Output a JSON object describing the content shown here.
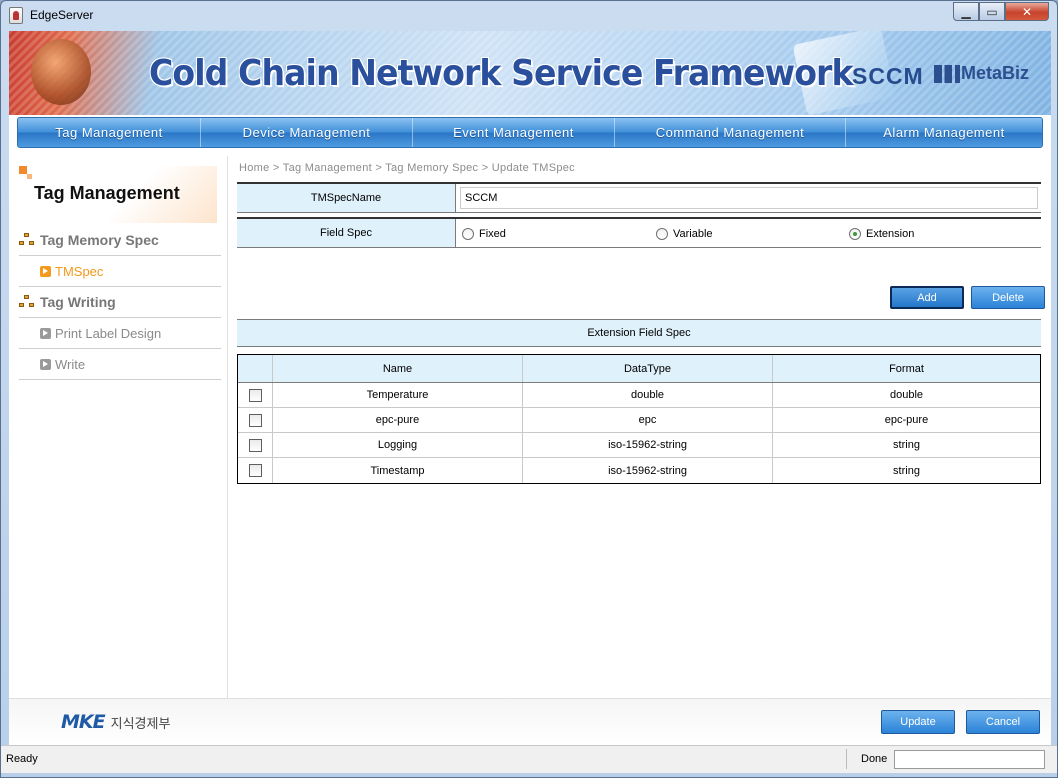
{
  "window": {
    "title": "EdgeServer"
  },
  "banner": {
    "headline": "Cold Chain Network Service Framework",
    "sccm": "SCCM",
    "metabiz": "MetaBiz"
  },
  "topnav": [
    {
      "label": "Tag Management",
      "w": 183
    },
    {
      "label": "Device Management",
      "w": 212
    },
    {
      "label": "Event Management",
      "w": 202
    },
    {
      "label": "Command Management",
      "w": 231
    },
    {
      "label": "Alarm Management",
      "w": 196
    }
  ],
  "sidebar": {
    "heading": "Tag Management",
    "items": [
      {
        "label": "Tag Memory Spec",
        "type": "cat"
      },
      {
        "label": "TMSpec",
        "type": "sub",
        "active": true
      },
      {
        "label": "Tag Writing",
        "type": "cat"
      },
      {
        "label": "Print Label Design",
        "type": "sub"
      },
      {
        "label": "Write",
        "type": "sub"
      }
    ]
  },
  "breadcrumb": "Home > Tag Management  >  Tag Memory Spec  >  Update TMSpec",
  "form": {
    "tmspec_label": "TMSpecName",
    "tmspec_value": "SCCM",
    "fieldspec_label": "Field Spec",
    "options": {
      "fixed": "Fixed",
      "variable": "Variable",
      "extension": "Extension"
    },
    "selected": "extension"
  },
  "buttons": {
    "add": "Add",
    "delete": "Delete",
    "update": "Update",
    "cancel": "Cancel"
  },
  "extension_title": "Extension Field Spec",
  "table": {
    "headers": [
      "Name",
      "DataType",
      "Format"
    ],
    "rows": [
      [
        "Temperature",
        "double",
        "double"
      ],
      [
        "epc-pure",
        "epc",
        "epc-pure"
      ],
      [
        "Logging",
        "iso-15962-string",
        "string"
      ],
      [
        "Timestamp",
        "iso-15962-string",
        "string"
      ]
    ]
  },
  "footer": {
    "logo": "MKE",
    "ministry": "지식경제부"
  },
  "status": {
    "left": "Ready",
    "right": "Done"
  },
  "colors": {
    "accent": "#2a82d7",
    "label_bg": "#dff1fb",
    "active": "#f39a1c"
  }
}
